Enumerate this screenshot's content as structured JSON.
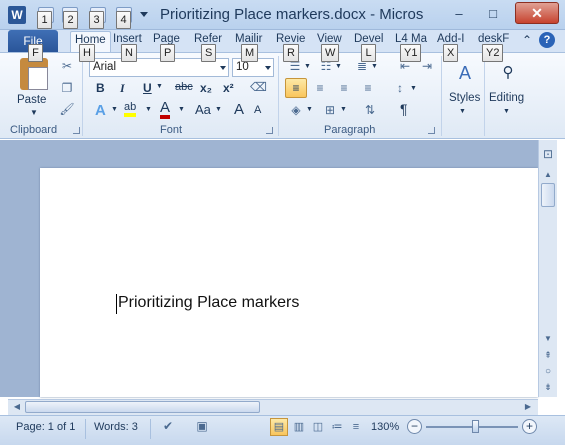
{
  "window": {
    "app_icon": "W",
    "title": "Prioritizing Place markers.docx  -  Micros",
    "minimize": "–",
    "maximize": "□",
    "close": "✕"
  },
  "qat_keytips": [
    "1",
    "2",
    "3",
    "4"
  ],
  "tabs": {
    "file": "File",
    "items": [
      "Home",
      "Insert",
      "Page",
      "Refer",
      "Mailir",
      "Revie",
      "View",
      "Devel",
      "L4 Ma",
      "Add-I",
      "deskF"
    ],
    "keytips": [
      "F",
      "H",
      "N",
      "P",
      "S",
      "M",
      "R",
      "W",
      "L",
      "Y1",
      "X",
      "Y2"
    ]
  },
  "ribbon": {
    "clipboard": {
      "paste_label": "Paste",
      "group_label": "Clipboard"
    },
    "font": {
      "font_name": "Arial",
      "font_size": "10",
      "bold": "B",
      "italic": "I",
      "underline": "U",
      "strike": "abc",
      "subscript": "x₂",
      "superscript": "x²",
      "grow": "A",
      "case": "Aa",
      "highlight_glyph": "ab",
      "group_label": "Font"
    },
    "paragraph": {
      "group_label": "Paragraph",
      "pilcrow": "¶"
    },
    "styles_label": "Styles",
    "editing_label": "Editing"
  },
  "document": {
    "text": "Prioritizing Place markers"
  },
  "status": {
    "page": "Page: 1 of 1",
    "words": "Words: 3",
    "zoom": "130%",
    "zoom_minus": "−",
    "zoom_plus": "+"
  },
  "colors": {
    "accent": "#2b5797",
    "font_color": "#c00000",
    "highlight": "#ffff00"
  }
}
